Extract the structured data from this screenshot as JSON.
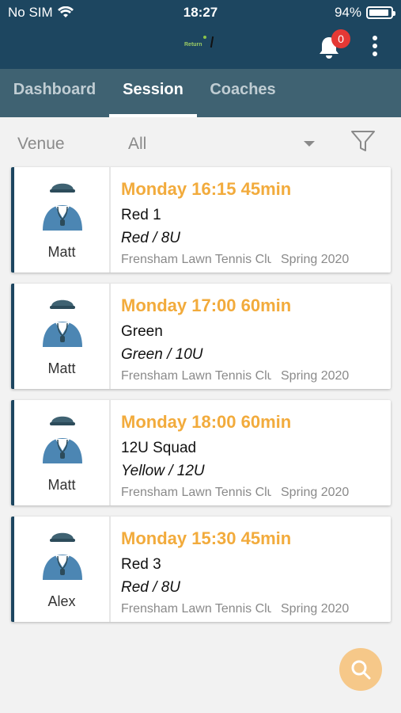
{
  "status": {
    "carrier": "No SIM",
    "time": "18:27",
    "battery": "94%",
    "battery_level": 0.94
  },
  "header": {
    "logo_text": "Return",
    "notification_count": "0"
  },
  "tabs": [
    {
      "label": "Dashboard"
    },
    {
      "label": "Session"
    },
    {
      "label": "Coaches"
    }
  ],
  "filter": {
    "label": "Venue",
    "value": "All"
  },
  "sessions": [
    {
      "coach": "Matt",
      "when": "Monday 16:15 45min",
      "group": "Red 1",
      "level": "Red / 8U",
      "venue": "Frensham Lawn Tennis Club",
      "term": "Spring 2020"
    },
    {
      "coach": "Matt",
      "when": "Monday 17:00 60min",
      "group": "Green",
      "level": "Green / 10U",
      "venue": "Frensham Lawn Tennis Club",
      "term": "Spring 2020"
    },
    {
      "coach": "Matt",
      "when": "Monday 18:00 60min",
      "group": "12U Squad",
      "level": "Yellow / 12U",
      "venue": "Frensham Lawn Tennis Club",
      "term": "Spring 2020"
    },
    {
      "coach": "Alex",
      "when": "Monday 15:30 45min",
      "group": "Red 3",
      "level": "Red / 8U",
      "venue": "Frensham Lawn Tennis Club",
      "term": "Spring 2020"
    }
  ],
  "icons": {
    "notify": "bell-icon",
    "menu": "more-vertical-icon",
    "filter": "filter-icon",
    "search": "search-icon",
    "coach": "coach-avatar-icon"
  },
  "colors": {
    "header": "#1d4660",
    "tabs": "#3f6272",
    "accent": "#f2ab3c",
    "badge": "#e53935"
  }
}
